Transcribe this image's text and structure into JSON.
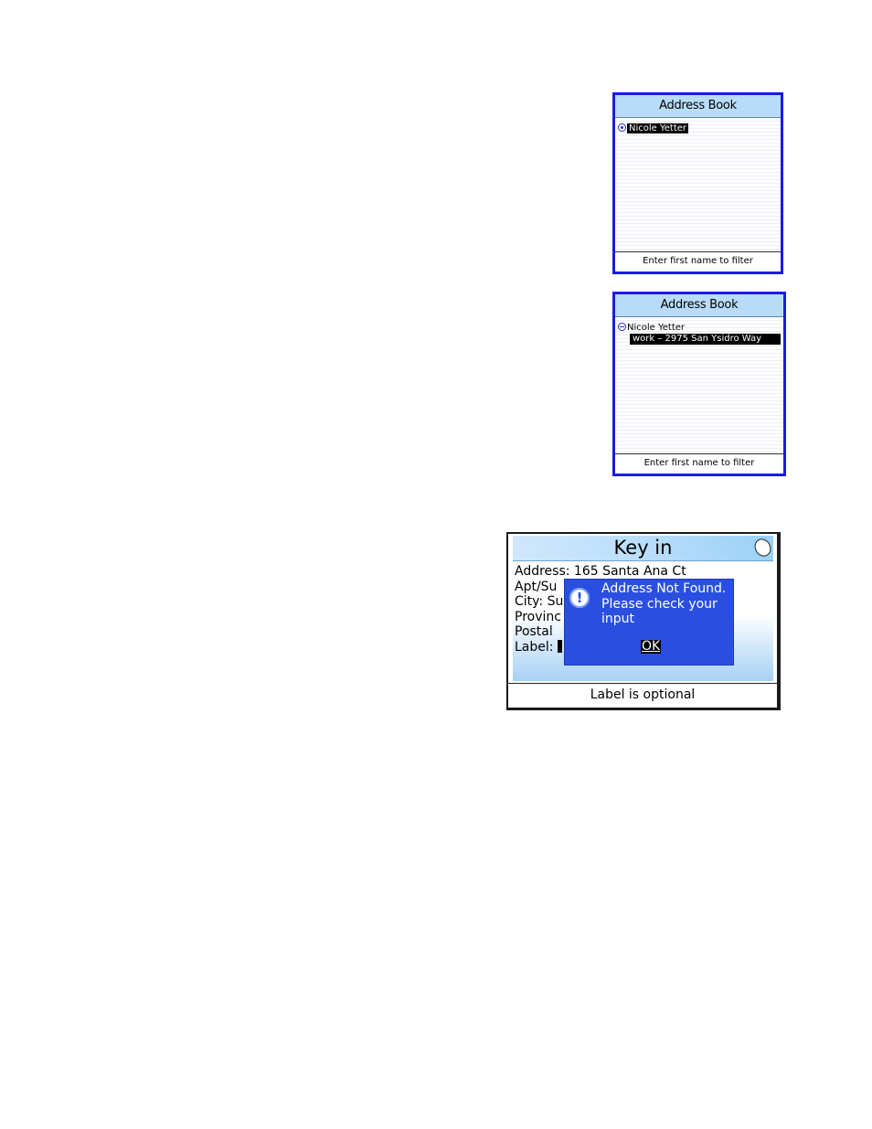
{
  "address_book_1": {
    "title": "Address Book",
    "contacts": [
      {
        "name": "Nicole  Yetter",
        "selected": true
      }
    ],
    "footer": "Enter first name to filter"
  },
  "address_book_2": {
    "title": "Address Book",
    "contact": {
      "name": "Nicole  Yetter"
    },
    "address_entry": {
      "label": "work – 2975 San Ysidro Way",
      "selected": true
    },
    "footer": "Enter first name to filter"
  },
  "key_in": {
    "title": "Key in",
    "fields": {
      "address": "Address: 165 Santa Ana Ct",
      "apt": "Apt/Su",
      "city": "City: Su",
      "province": "Provinc",
      "postal": "Postal",
      "label": "Label:"
    },
    "dialog": {
      "message_lines": [
        "Address Not Found.",
        "Please check your",
        "input"
      ],
      "ok_label": "OK"
    },
    "footer": "Label is optional"
  },
  "colors": {
    "screen_border": "#1a1ae6",
    "title_bar": "#b8dcf8",
    "dialog_bg": "#2a4fe0"
  }
}
